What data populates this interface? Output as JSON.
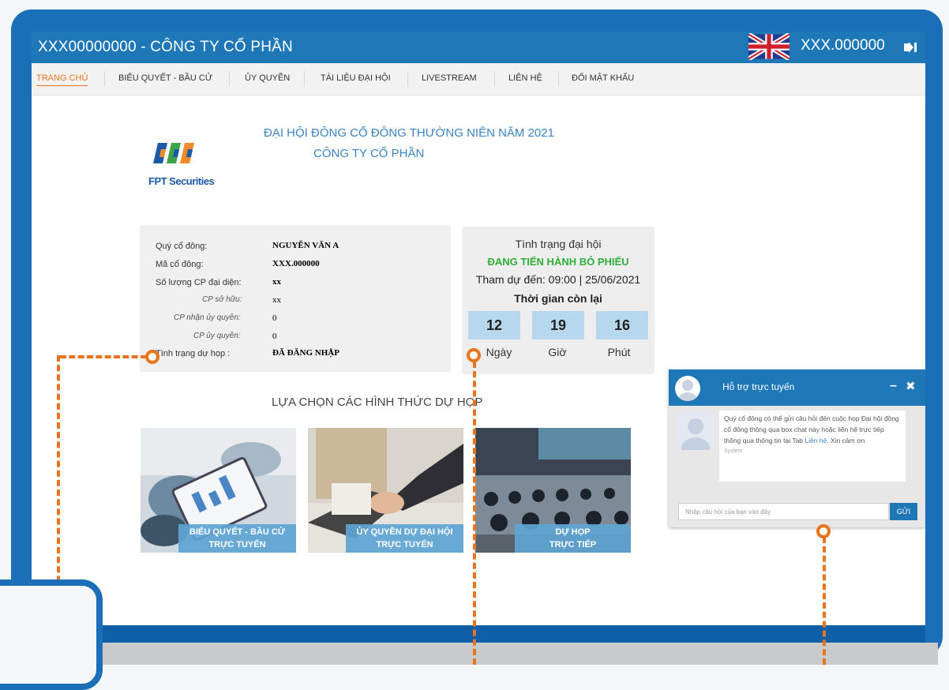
{
  "app": {
    "title": "XXX00000000 - CÔNG TY CỔ PHẦN",
    "account": "XXX.000000"
  },
  "nav": [
    {
      "label": "TRANG CHỦ"
    },
    {
      "label": "BIỂU QUYẾT - BẦU CỬ"
    },
    {
      "label": "ỦY QUYỀN"
    },
    {
      "label": "TÀI LIỆU ĐẠI HỘI"
    },
    {
      "label": "LIVESTREAM"
    },
    {
      "label": "LIÊN HỆ"
    },
    {
      "label": "ĐỔI MẬT KHẨU"
    }
  ],
  "header": {
    "logo_text": "FPT Securities",
    "meeting_title": "ĐẠI HỘI ĐÔNG CỔ ĐÔNG THƯỜNG NIÊN NĂM 2021",
    "company": "CÔNG TY CỔ PHẦN"
  },
  "shareholder": {
    "rows": [
      {
        "label": "Quý cổ đông:",
        "value": "NGUYỄN VĂN A"
      },
      {
        "label": "Mã cổ đông:",
        "value": "XXX.000000"
      },
      {
        "label": "Số lượng CP đại diện:",
        "value": "xx"
      },
      {
        "label": "CP sở hữu:",
        "value": "xx"
      },
      {
        "label": "CP nhận ủy quyền:",
        "value": "0"
      },
      {
        "label": "CP ủy quyền:",
        "value": "0"
      },
      {
        "label": "Tình trạng dự họp :",
        "value": "ĐÃ ĐĂNG NHẬP"
      }
    ]
  },
  "status": {
    "heading": "Tình trạng đại hội",
    "state": "ĐANG TIẾN HÀNH BỎ PHIẾU",
    "attend": "Tham dự đến: 09:00 | 25/06/2021",
    "remaining_label": "Thời gian còn lại",
    "countdown": [
      {
        "value": "12",
        "unit": "Ngày"
      },
      {
        "value": "19",
        "unit": "Giờ"
      },
      {
        "value": "16",
        "unit": "Phút"
      }
    ],
    "color": "#2fae3a"
  },
  "options": {
    "title": "LỰA CHỌN CÁC HÌNH THỨC DỰ HỌP",
    "items": [
      {
        "line1": "BIỂU QUYẾT - BẦU CỬ",
        "line2": "TRỰC TUYẾN"
      },
      {
        "line1": "ỦY QUYỀN DỰ ĐẠI HỘI",
        "line2": "TRỰC TUYẾN"
      },
      {
        "line1": "DỰ HỌP",
        "line2": "TRỰC TIẾP"
      }
    ]
  },
  "chat": {
    "title": "Hỗ trợ trực tuyến",
    "message": "Quý cổ đông có thể gửi câu hỏi đến cuộc họp Đại hội đồng cổ đông thông qua box chat này hoặc liên hệ trực tiếp thông qua thông tin tại Tab",
    "link": "Liên hệ",
    "message_end": ". Xin cảm ơn",
    "sender": "System",
    "placeholder": "Nhập câu hỏi của bạn vào đây",
    "send": "GỬI"
  },
  "colors": {
    "brand": "#1e78b8",
    "accent": "#e8741e",
    "frame": "#1b6fb8"
  }
}
